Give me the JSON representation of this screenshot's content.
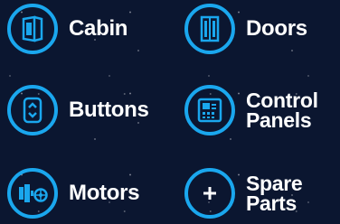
{
  "colors": {
    "accent": "#1aa7ee",
    "background": "#0b1630",
    "text": "#ffffff"
  },
  "menu": {
    "cabin": {
      "label": "Cabin",
      "icon": "cabin-icon"
    },
    "doors": {
      "label": "Doors",
      "icon": "doors-icon"
    },
    "buttons": {
      "label": "Buttons",
      "icon": "buttons-icon"
    },
    "control_panels": {
      "line1": "Control",
      "line2": "Panels",
      "icon": "control-panel-icon"
    },
    "motors": {
      "label": "Motors",
      "icon": "motors-icon"
    },
    "spare_parts": {
      "line1": "Spare",
      "line2": "Parts",
      "icon": "plus-icon"
    }
  }
}
